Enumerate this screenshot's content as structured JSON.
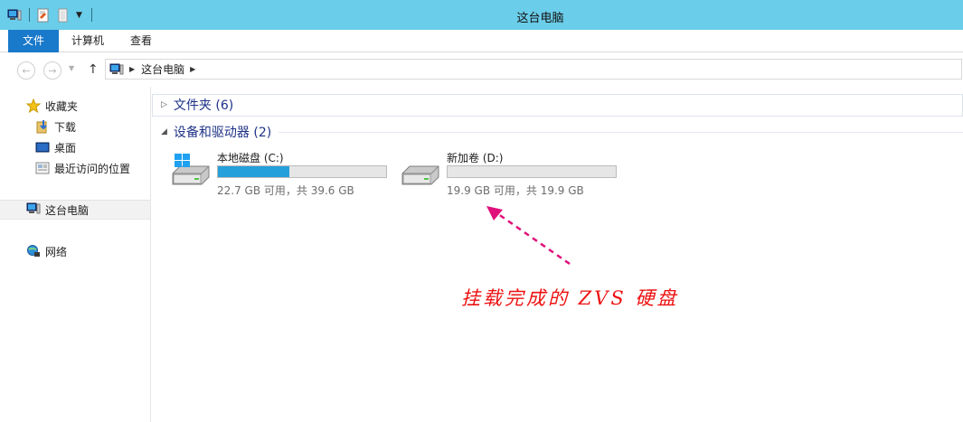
{
  "window": {
    "title": "这台电脑"
  },
  "ribbon": {
    "tabs": [
      {
        "label": "文件",
        "active": true
      },
      {
        "label": "计算机"
      },
      {
        "label": "查看"
      }
    ]
  },
  "address_bar": {
    "crumbs": [
      "这台电脑"
    ]
  },
  "nav_pane": {
    "favorites_label": "收藏夹",
    "favorites": [
      "下载",
      "桌面",
      "最近访问的位置"
    ],
    "this_pc": "这台电脑",
    "network": "网络"
  },
  "content": {
    "folders_group": "文件夹 (6)",
    "devices_group": "设备和驱动器 (2)",
    "drives": [
      {
        "name": "本地磁盘 (C:)",
        "free_text": "22.7 GB 可用，共 39.6 GB",
        "used_fraction": 0.427
      },
      {
        "name": "新加卷 (D:)",
        "free_text": "19.9 GB 可用，共 19.9 GB",
        "used_fraction": 0.0
      }
    ]
  },
  "annotation": {
    "text": "挂载完成的 ZVS 硬盘"
  },
  "colors": {
    "titlebar": "#6acde9",
    "file_tab": "#1979ca",
    "drive_bar_fill": "#26a0da",
    "annotation": "#ee1111"
  }
}
